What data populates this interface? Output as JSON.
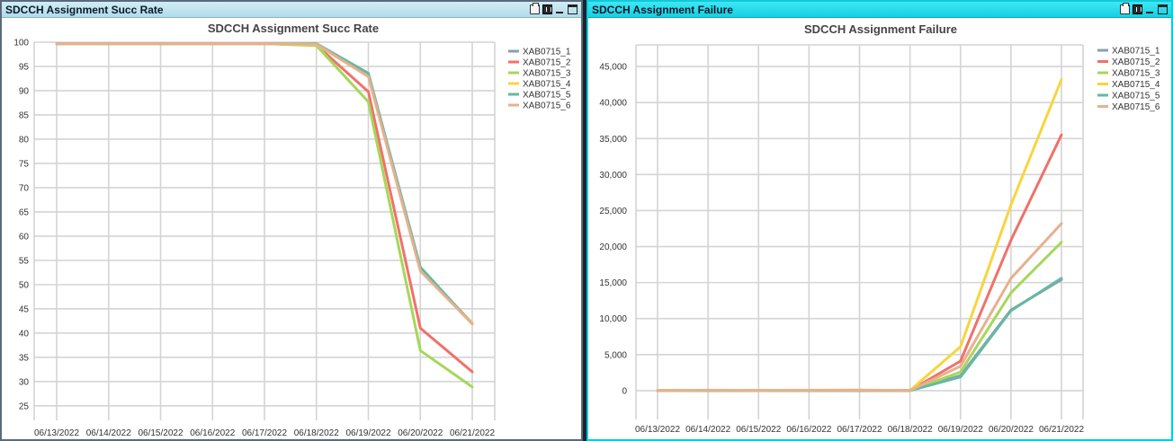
{
  "window": {
    "left_panel_title": "SDCCH Assignment Succ Rate",
    "right_panel_title": "SDCCH Assignment Failure"
  },
  "colors": {
    "XAB0715_1": "#8a9fb0",
    "XAB0715_2": "#f0716a",
    "XAB0715_3": "#a6d75a",
    "XAB0715_4": "#f8d53e",
    "XAB0715_5": "#66b8a4",
    "XAB0715_6": "#e8b08e"
  },
  "chart_data": [
    {
      "type": "line",
      "title": "SDCCH Assignment Succ Rate",
      "x": [
        "06/13/2022",
        "06/14/2022",
        "06/15/2022",
        "06/16/2022",
        "06/17/2022",
        "06/18/2022",
        "06/19/2022",
        "06/20/2022",
        "06/21/2022"
      ],
      "yticks": [
        "100",
        "95",
        "90",
        "85",
        "80",
        "75",
        "70",
        "65",
        "60",
        "55",
        "50",
        "45",
        "40",
        "35",
        "30",
        "25"
      ],
      "ylim": [
        22,
        100
      ],
      "grid": true,
      "legend": "right",
      "series": [
        {
          "name": "XAB0715_1",
          "values": [
            99.7,
            99.7,
            99.7,
            99.7,
            99.7,
            99.6,
            93.2,
            53.3,
            42.0
          ]
        },
        {
          "name": "XAB0715_2",
          "values": [
            99.7,
            99.7,
            99.7,
            99.7,
            99.7,
            99.4,
            89.8,
            41.0,
            32.0
          ]
        },
        {
          "name": "XAB0715_3",
          "values": [
            99.7,
            99.7,
            99.7,
            99.7,
            99.7,
            99.3,
            87.7,
            36.4,
            28.9
          ]
        },
        {
          "name": "XAB0715_4",
          "values": [
            99.7,
            99.7,
            99.7,
            99.7,
            99.7,
            99.5,
            93.0,
            53.1,
            42.1
          ]
        },
        {
          "name": "XAB0715_5",
          "values": [
            99.7,
            99.7,
            99.7,
            99.7,
            99.7,
            99.7,
            93.6,
            53.6,
            41.9
          ]
        },
        {
          "name": "XAB0715_6",
          "values": [
            99.7,
            99.7,
            99.7,
            99.7,
            99.7,
            99.6,
            92.9,
            52.8,
            41.9
          ]
        }
      ]
    },
    {
      "type": "line",
      "title": "SDCCH Assignment Failure",
      "x": [
        "06/13/2022",
        "06/14/2022",
        "06/15/2022",
        "06/16/2022",
        "06/17/2022",
        "06/18/2022",
        "06/19/2022",
        "06/20/2022",
        "06/21/2022"
      ],
      "yticks": [
        "45,000",
        "40,000",
        "35,000",
        "30,000",
        "25,000",
        "20,000",
        "15,000",
        "10,000",
        "5,000",
        "0"
      ],
      "ylim": [
        -4000,
        48000
      ],
      "grid": true,
      "legend": "right",
      "series": [
        {
          "name": "XAB0715_1",
          "values": [
            0,
            0,
            0,
            0,
            0,
            0,
            2100,
            11200,
            15400
          ]
        },
        {
          "name": "XAB0715_2",
          "values": [
            0,
            50,
            30,
            40,
            60,
            20,
            4100,
            20900,
            35500
          ]
        },
        {
          "name": "XAB0715_3",
          "values": [
            0,
            30,
            20,
            30,
            40,
            10,
            2600,
            13600,
            20600
          ]
        },
        {
          "name": "XAB0715_4",
          "values": [
            0,
            70,
            40,
            60,
            80,
            30,
            6100,
            25800,
            43200
          ]
        },
        {
          "name": "XAB0715_5",
          "values": [
            0,
            0,
            0,
            0,
            0,
            0,
            1900,
            11100,
            15600
          ]
        },
        {
          "name": "XAB0715_6",
          "values": [
            0,
            40,
            30,
            40,
            50,
            20,
            3400,
            15600,
            23200
          ]
        }
      ]
    }
  ]
}
